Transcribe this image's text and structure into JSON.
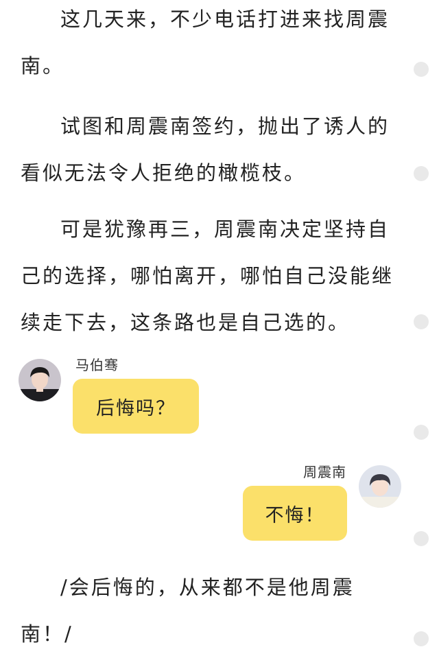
{
  "story": {
    "paragraph_1": "这几天来，不少电话打进来找周震南。",
    "paragraph_2": "试图和周震南签约，抛出了诱人的看似无法令人拒绝的橄榄枝。",
    "paragraph_3": "可是犹豫再三，周震南决定坚持自己的选择，哪怕离开，哪怕自己没能继续走下去，这条路也是自己选的。",
    "paragraph_4": "/会后悔的，从来都不是他周震南！/"
  },
  "chat": {
    "left": {
      "speaker": "马伯骞",
      "message": "后悔吗？"
    },
    "right": {
      "speaker": "周震南",
      "message": "不悔！"
    }
  },
  "colors": {
    "bubble": "#fbe06a",
    "text": "#222222",
    "scroll_dot": "#e9e9e9"
  }
}
